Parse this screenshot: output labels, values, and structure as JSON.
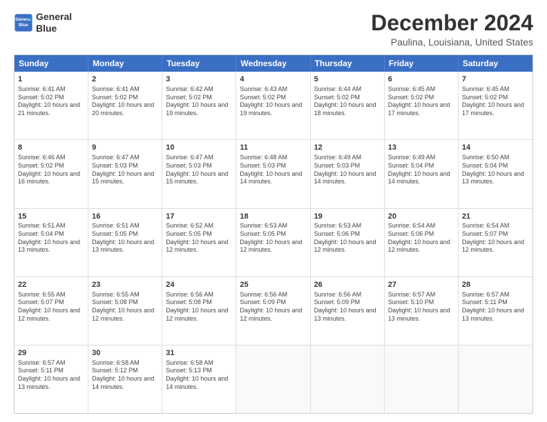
{
  "logo": {
    "line1": "General",
    "line2": "Blue"
  },
  "title": "December 2024",
  "subtitle": "Paulina, Louisiana, United States",
  "days": [
    "Sunday",
    "Monday",
    "Tuesday",
    "Wednesday",
    "Thursday",
    "Friday",
    "Saturday"
  ],
  "rows": [
    [
      {
        "day": "1",
        "rise": "6:41 AM",
        "set": "5:02 PM",
        "daylight": "10 hours and 21 minutes."
      },
      {
        "day": "2",
        "rise": "6:41 AM",
        "set": "5:02 PM",
        "daylight": "10 hours and 20 minutes."
      },
      {
        "day": "3",
        "rise": "6:42 AM",
        "set": "5:02 PM",
        "daylight": "10 hours and 19 minutes."
      },
      {
        "day": "4",
        "rise": "6:43 AM",
        "set": "5:02 PM",
        "daylight": "10 hours and 19 minutes."
      },
      {
        "day": "5",
        "rise": "6:44 AM",
        "set": "5:02 PM",
        "daylight": "10 hours and 18 minutes."
      },
      {
        "day": "6",
        "rise": "6:45 AM",
        "set": "5:02 PM",
        "daylight": "10 hours and 17 minutes."
      },
      {
        "day": "7",
        "rise": "6:45 AM",
        "set": "5:02 PM",
        "daylight": "10 hours and 17 minutes."
      }
    ],
    [
      {
        "day": "8",
        "rise": "6:46 AM",
        "set": "5:02 PM",
        "daylight": "10 hours and 16 minutes."
      },
      {
        "day": "9",
        "rise": "6:47 AM",
        "set": "5:03 PM",
        "daylight": "10 hours and 15 minutes."
      },
      {
        "day": "10",
        "rise": "6:47 AM",
        "set": "5:03 PM",
        "daylight": "10 hours and 15 minutes."
      },
      {
        "day": "11",
        "rise": "6:48 AM",
        "set": "5:03 PM",
        "daylight": "10 hours and 14 minutes."
      },
      {
        "day": "12",
        "rise": "6:49 AM",
        "set": "5:03 PM",
        "daylight": "10 hours and 14 minutes."
      },
      {
        "day": "13",
        "rise": "6:49 AM",
        "set": "5:04 PM",
        "daylight": "10 hours and 14 minutes."
      },
      {
        "day": "14",
        "rise": "6:50 AM",
        "set": "5:04 PM",
        "daylight": "10 hours and 13 minutes."
      }
    ],
    [
      {
        "day": "15",
        "rise": "6:51 AM",
        "set": "5:04 PM",
        "daylight": "10 hours and 13 minutes."
      },
      {
        "day": "16",
        "rise": "6:51 AM",
        "set": "5:05 PM",
        "daylight": "10 hours and 13 minutes."
      },
      {
        "day": "17",
        "rise": "6:52 AM",
        "set": "5:05 PM",
        "daylight": "10 hours and 12 minutes."
      },
      {
        "day": "18",
        "rise": "6:53 AM",
        "set": "5:05 PM",
        "daylight": "10 hours and 12 minutes."
      },
      {
        "day": "19",
        "rise": "6:53 AM",
        "set": "5:06 PM",
        "daylight": "10 hours and 12 minutes."
      },
      {
        "day": "20",
        "rise": "6:54 AM",
        "set": "5:06 PM",
        "daylight": "10 hours and 12 minutes."
      },
      {
        "day": "21",
        "rise": "6:54 AM",
        "set": "5:07 PM",
        "daylight": "10 hours and 12 minutes."
      }
    ],
    [
      {
        "day": "22",
        "rise": "6:55 AM",
        "set": "5:07 PM",
        "daylight": "10 hours and 12 minutes."
      },
      {
        "day": "23",
        "rise": "6:55 AM",
        "set": "5:08 PM",
        "daylight": "10 hours and 12 minutes."
      },
      {
        "day": "24",
        "rise": "6:56 AM",
        "set": "5:08 PM",
        "daylight": "10 hours and 12 minutes."
      },
      {
        "day": "25",
        "rise": "6:56 AM",
        "set": "5:09 PM",
        "daylight": "10 hours and 12 minutes."
      },
      {
        "day": "26",
        "rise": "6:56 AM",
        "set": "5:09 PM",
        "daylight": "10 hours and 13 minutes."
      },
      {
        "day": "27",
        "rise": "6:57 AM",
        "set": "5:10 PM",
        "daylight": "10 hours and 13 minutes."
      },
      {
        "day": "28",
        "rise": "6:57 AM",
        "set": "5:11 PM",
        "daylight": "10 hours and 13 minutes."
      }
    ],
    [
      {
        "day": "29",
        "rise": "6:57 AM",
        "set": "5:11 PM",
        "daylight": "10 hours and 13 minutes."
      },
      {
        "day": "30",
        "rise": "6:58 AM",
        "set": "5:12 PM",
        "daylight": "10 hours and 14 minutes."
      },
      {
        "day": "31",
        "rise": "6:58 AM",
        "set": "5:13 PM",
        "daylight": "10 hours and 14 minutes."
      },
      null,
      null,
      null,
      null
    ]
  ]
}
